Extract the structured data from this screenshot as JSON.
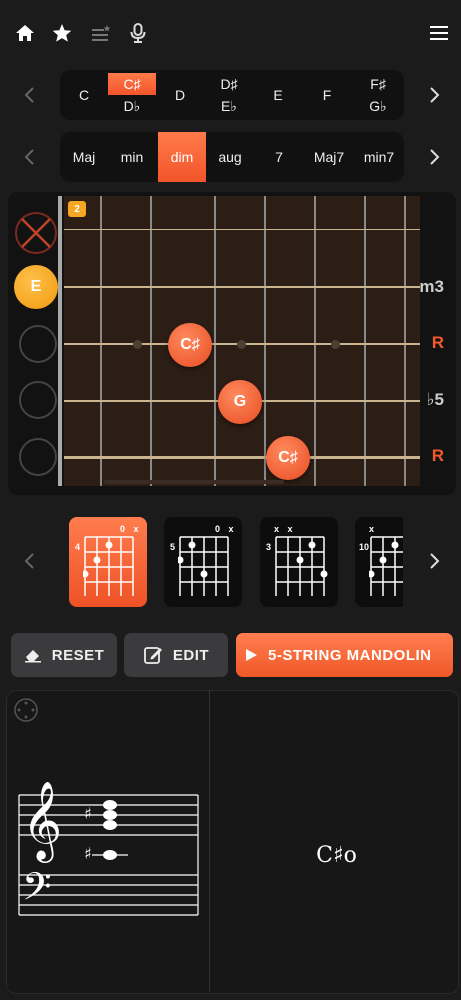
{
  "top_bar": {
    "icons": [
      "home-icon",
      "star-icon",
      "playlist-add-icon",
      "microphone-icon",
      "menu-icon"
    ]
  },
  "roots": [
    {
      "top": "",
      "main": "C",
      "bottom": ""
    },
    {
      "top": "C♯",
      "main": "",
      "bottom": "D♭",
      "selected": true
    },
    {
      "top": "",
      "main": "D",
      "bottom": ""
    },
    {
      "top": "D♯",
      "main": "",
      "bottom": "E♭"
    },
    {
      "top": "",
      "main": "E",
      "bottom": ""
    },
    {
      "top": "",
      "main": "F",
      "bottom": ""
    },
    {
      "top": "F♯",
      "main": "",
      "bottom": "G♭"
    }
  ],
  "qualities": [
    "Maj",
    "min",
    "dim",
    "aug",
    "7",
    "Maj7",
    "min7"
  ],
  "selected_quality": "dim",
  "fretboard": {
    "start_fret": "2",
    "open_markers": [
      "",
      "E",
      "",
      "",
      ""
    ],
    "intervals": [
      "",
      "m3",
      "R",
      "♭5",
      "R"
    ],
    "notes": [
      {
        "label": "C♯",
        "string": 3,
        "fret": 2
      },
      {
        "label": "G",
        "string": 4,
        "fret": 3
      },
      {
        "label": "C♯",
        "string": 5,
        "fret": 4
      }
    ]
  },
  "chord_variants": [
    {
      "fret": "4",
      "markers": "0 x",
      "selected": true
    },
    {
      "fret": "5",
      "markers": "0 x"
    },
    {
      "fret": "3",
      "markers": "x x"
    },
    {
      "fret": "10",
      "markers": "x"
    }
  ],
  "buttons": {
    "reset": "RESET",
    "edit": "EDIT",
    "instrument": "5-STRING MANDOLIN"
  },
  "chord_name": "C♯o",
  "colors": {
    "accent": "#f25a2b",
    "highlight": "#f5a623",
    "background": "#1b1b1c"
  }
}
